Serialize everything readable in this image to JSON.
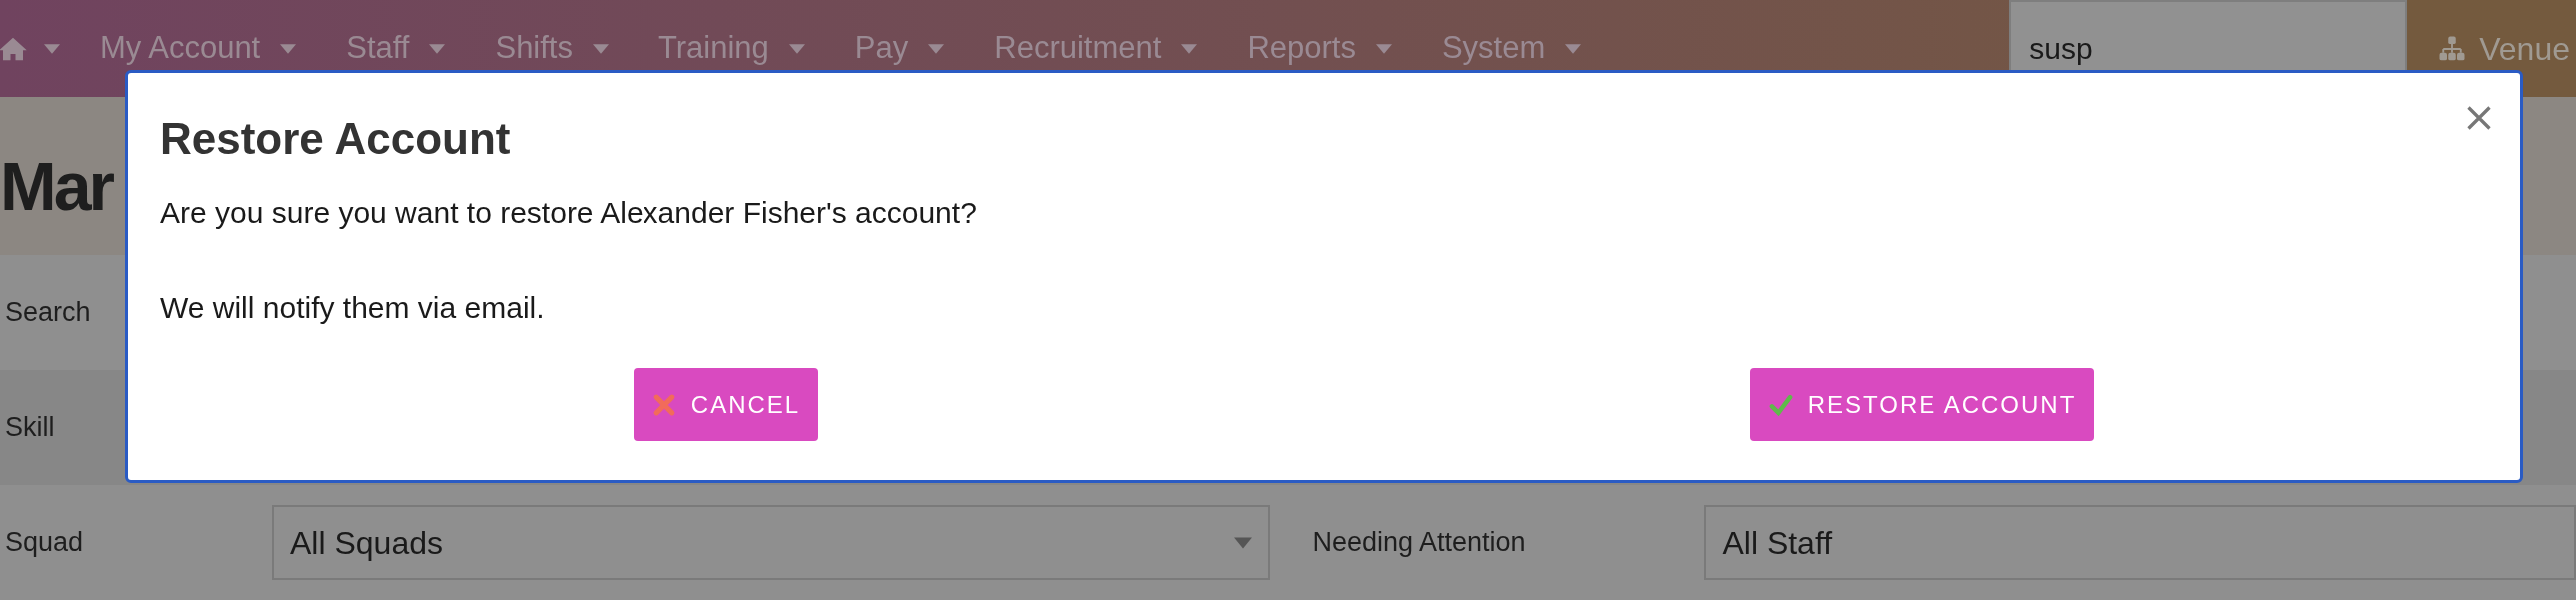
{
  "nav": {
    "items": [
      {
        "label": "My Account"
      },
      {
        "label": "Staff"
      },
      {
        "label": "Shifts"
      },
      {
        "label": "Training"
      },
      {
        "label": "Pay"
      },
      {
        "label": "Recruitment"
      },
      {
        "label": "Reports"
      },
      {
        "label": "System"
      }
    ],
    "search": {
      "value": "susp"
    },
    "venue": {
      "label": "Venue"
    }
  },
  "page_title": "Mar",
  "filters": [
    {
      "label": "Search"
    },
    {
      "label": "Skill"
    },
    {
      "label": "Squad",
      "select": "All Squads",
      "second_label": "Needing Attention",
      "second_select": "All Staff"
    }
  ],
  "dialog": {
    "title": "Restore Account",
    "paragraphs": [
      "Are you sure you want to restore Alexander Fisher's account?",
      "We will notify them via email."
    ],
    "buttons": [
      {
        "label": "CANCEL",
        "kind": "cancel"
      },
      {
        "label": "RESTORE ACCOUNT",
        "kind": "confirm"
      }
    ]
  }
}
